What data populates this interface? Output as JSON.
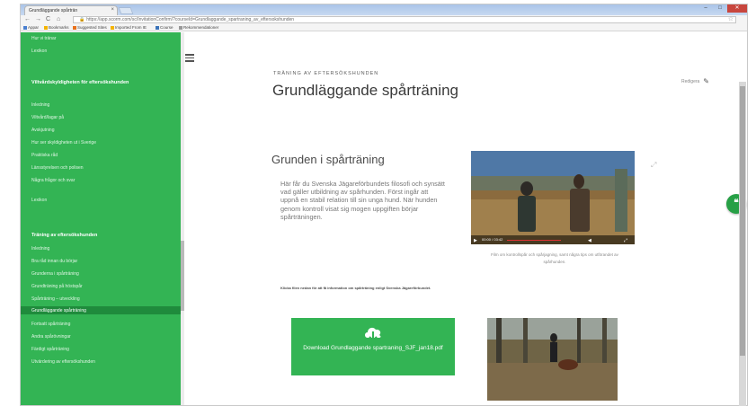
{
  "browser": {
    "tab_title": "Grundläggande spårträn",
    "tab_close": "×",
    "window_title": "",
    "url_scheme": "https://",
    "url_rest": "app.scorm.com/sc/InvitationConfirm/?courseId=Grundlaggande_spartraning_av_eftersokshunden",
    "lock": "🔒",
    "star": "☆",
    "menu": "≡",
    "back": "←",
    "forward": "→",
    "reload": "C",
    "home": "⌂",
    "minimize": "–",
    "maximize": "□",
    "close": "✕",
    "bookmarks": [
      "Appar",
      "Bookmarks",
      "Suggested Sites",
      "Imported From IE",
      "Course",
      "Rekommendationer"
    ]
  },
  "sidebar": {
    "top_items": [
      "Hur vi tränar",
      "Lexikon"
    ],
    "section1_title": "Viltvårdskyldigheten för eftersökshunden",
    "section1_items": [
      "Inledning",
      "Viltvård/lagar på",
      "Avskjutning",
      "Hur ser skyldigheten ut i Sverige",
      "Praktiska råd",
      "Länsstyrelsen och polisen",
      "Några frågor och svar",
      "Lexikon"
    ],
    "section2_title": "Träning av eftersökshunden",
    "section2_items": [
      "Inledning",
      "Bra råd innan du börjar",
      "Grunderna i spårträning",
      "Grundträning på höstspår",
      "Spårträning – utveckling",
      "Grundläggande spårträning",
      "Fortsatt spårträning",
      "Andra spårövningar",
      "Färdigt spårträning",
      "Utvärdering av eftersökshunden"
    ]
  },
  "header": {
    "eyebrow": "TRÄNING AV EFTERSÖKSHUNDEN",
    "title": "Grundläggande spårträning",
    "editor_label": "Redigera",
    "pencil": "✎"
  },
  "content": {
    "section_title": "Grunden i spårträning",
    "body": "Här får du Svenska Jägareförbundets filosofi och synsätt vad gäller utbildning av spårhunden. Först ingår att uppnå en stabil relation till sin unga hund. När hunden genom kontroll visat sig mogen uppgiften börjar spårträningen.",
    "note": "Klicka filen nedan för att få information om spårträning enligt Svenska Jägareförbundet.",
    "video_time": "00:00 / 03:42",
    "video_caption": "Film om kontrollspår och spårjagning, samt några tips om utförandet av spårhunden.",
    "expand": "⤢",
    "download_label": "Download Grundlaggande spartraning_SJF_jan18.pdf"
  },
  "fab": {
    "label": "❝"
  },
  "colors": {
    "accent": "#33b454",
    "accent_dark": "#1f8b3c"
  }
}
